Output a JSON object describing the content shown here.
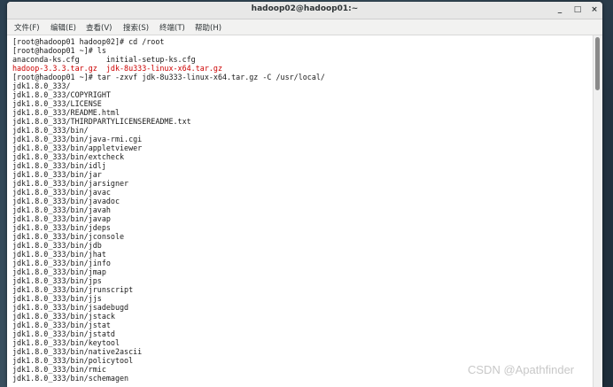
{
  "window": {
    "title": "hadoop02@hadoop01:~",
    "controls": {
      "minimize": "_",
      "maximize": "□",
      "close": "×"
    }
  },
  "menu": [
    "文件(F)",
    "编辑(E)",
    "查看(V)",
    "搜索(S)",
    "终端(T)",
    "帮助(H)"
  ],
  "terminal_lines": [
    {
      "text": "[root@hadoop01 hadoop02]# cd /root",
      "color": "normal"
    },
    {
      "text": "[root@hadoop01 ~]# ls",
      "color": "normal"
    },
    {
      "text": "anaconda-ks.cfg      initial-setup-ks.cfg",
      "color": "normal"
    },
    {
      "text": "hadoop-3.3.3.tar.gz  jdk-8u333-linux-x64.tar.gz",
      "color": "red"
    },
    {
      "text": "[root@hadoop01 ~]# tar -zxvf jdk-8u333-linux-x64.tar.gz -C /usr/local/",
      "color": "normal"
    },
    {
      "text": "jdk1.8.0_333/",
      "color": "normal"
    },
    {
      "text": "jdk1.8.0_333/COPYRIGHT",
      "color": "normal"
    },
    {
      "text": "jdk1.8.0_333/LICENSE",
      "color": "normal"
    },
    {
      "text": "jdk1.8.0_333/README.html",
      "color": "normal"
    },
    {
      "text": "jdk1.8.0_333/THIRDPARTYLICENSEREADME.txt",
      "color": "normal"
    },
    {
      "text": "jdk1.8.0_333/bin/",
      "color": "normal"
    },
    {
      "text": "jdk1.8.0_333/bin/java-rmi.cgi",
      "color": "normal"
    },
    {
      "text": "jdk1.8.0_333/bin/appletviewer",
      "color": "normal"
    },
    {
      "text": "jdk1.8.0_333/bin/extcheck",
      "color": "normal"
    },
    {
      "text": "jdk1.8.0_333/bin/idlj",
      "color": "normal"
    },
    {
      "text": "jdk1.8.0_333/bin/jar",
      "color": "normal"
    },
    {
      "text": "jdk1.8.0_333/bin/jarsigner",
      "color": "normal"
    },
    {
      "text": "jdk1.8.0_333/bin/javac",
      "color": "normal"
    },
    {
      "text": "jdk1.8.0_333/bin/javadoc",
      "color": "normal"
    },
    {
      "text": "jdk1.8.0_333/bin/javah",
      "color": "normal"
    },
    {
      "text": "jdk1.8.0_333/bin/javap",
      "color": "normal"
    },
    {
      "text": "jdk1.8.0_333/bin/jdeps",
      "color": "normal"
    },
    {
      "text": "jdk1.8.0_333/bin/jconsole",
      "color": "normal"
    },
    {
      "text": "jdk1.8.0_333/bin/jdb",
      "color": "normal"
    },
    {
      "text": "jdk1.8.0_333/bin/jhat",
      "color": "normal"
    },
    {
      "text": "jdk1.8.0_333/bin/jinfo",
      "color": "normal"
    },
    {
      "text": "jdk1.8.0_333/bin/jmap",
      "color": "normal"
    },
    {
      "text": "jdk1.8.0_333/bin/jps",
      "color": "normal"
    },
    {
      "text": "jdk1.8.0_333/bin/jrunscript",
      "color": "normal"
    },
    {
      "text": "jdk1.8.0_333/bin/jjs",
      "color": "normal"
    },
    {
      "text": "jdk1.8.0_333/bin/jsadebugd",
      "color": "normal"
    },
    {
      "text": "jdk1.8.0_333/bin/jstack",
      "color": "normal"
    },
    {
      "text": "jdk1.8.0_333/bin/jstat",
      "color": "normal"
    },
    {
      "text": "jdk1.8.0_333/bin/jstatd",
      "color": "normal"
    },
    {
      "text": "jdk1.8.0_333/bin/keytool",
      "color": "normal"
    },
    {
      "text": "jdk1.8.0_333/bin/native2ascii",
      "color": "normal"
    },
    {
      "text": "jdk1.8.0_333/bin/policytool",
      "color": "normal"
    },
    {
      "text": "jdk1.8.0_333/bin/rmic",
      "color": "normal"
    },
    {
      "text": "jdk1.8.0_333/bin/schemagen",
      "color": "normal"
    }
  ],
  "colors": {
    "red": "#cc0000",
    "text": "#1a1a1a"
  },
  "watermark": "CSDN @Apathfinder"
}
